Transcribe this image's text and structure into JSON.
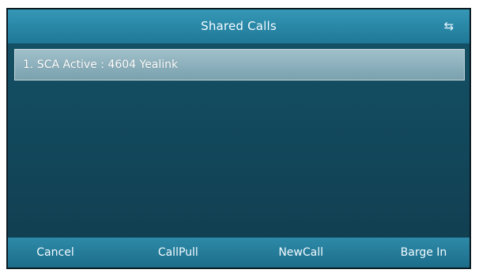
{
  "screen": {
    "title": "Shared Calls",
    "status_icon": "phone-status-icon",
    "status_glyph": "⇆"
  },
  "list": {
    "items": [
      {
        "label": "1. SCA Active : 4604 Yealink"
      }
    ]
  },
  "softkeys": {
    "items": [
      {
        "label": "Cancel"
      },
      {
        "label": "CallPull"
      },
      {
        "label": "NewCall"
      },
      {
        "label": "Barge In"
      }
    ]
  },
  "colors": {
    "title_bar": "#2a87a6",
    "content_background": "#12485b",
    "selected_item": "#8db1bd",
    "softkey_bar": "#247b99"
  }
}
